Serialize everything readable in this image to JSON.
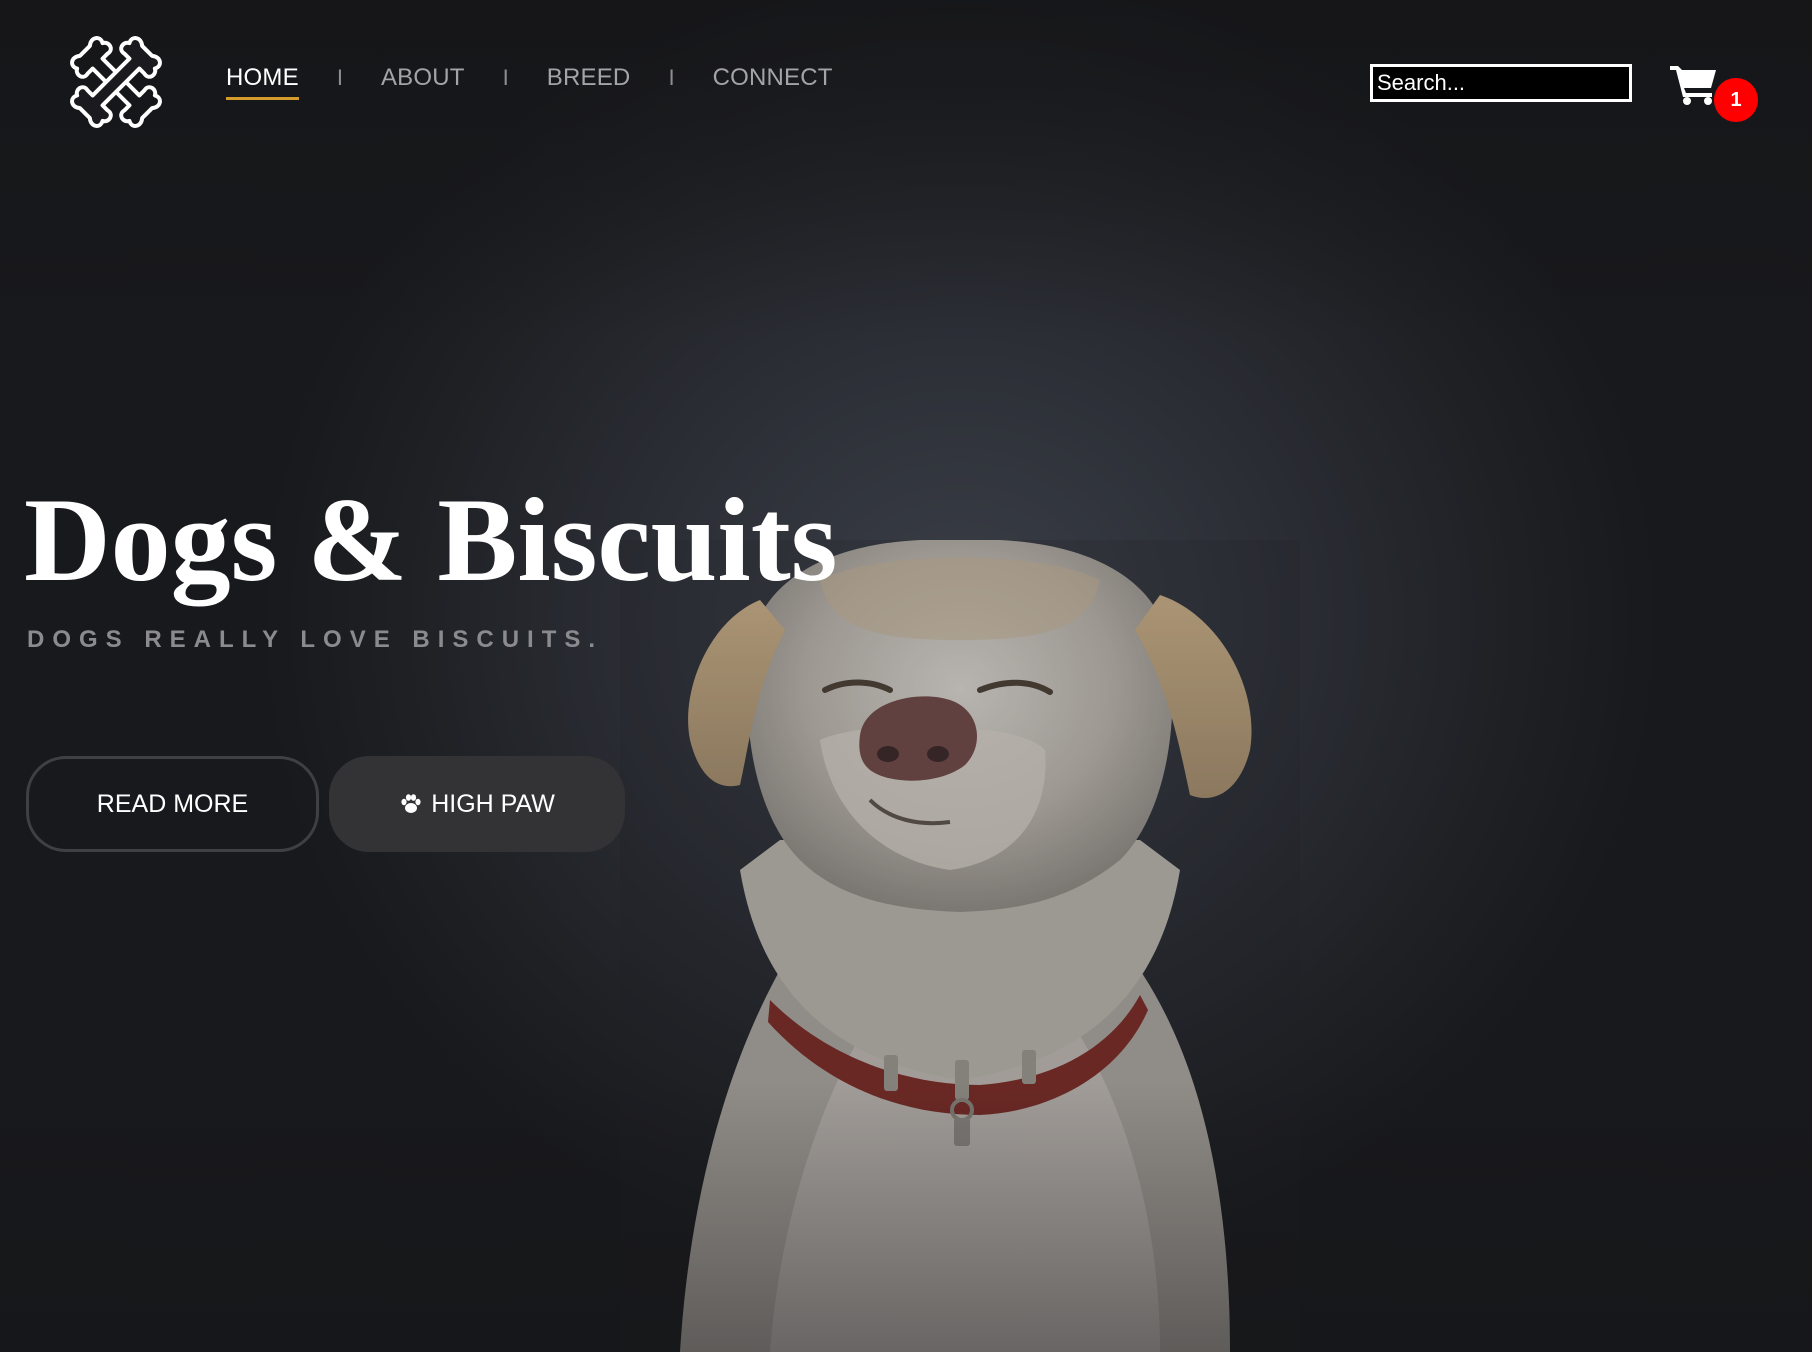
{
  "nav": {
    "items": [
      {
        "label": "HOME",
        "active": true
      },
      {
        "label": "ABOUT",
        "active": false
      },
      {
        "label": "BREED",
        "active": false
      },
      {
        "label": "CONNECT",
        "active": false
      }
    ],
    "separator": "I"
  },
  "search": {
    "placeholder": "Search..."
  },
  "cart": {
    "count": "1",
    "icon": "cart-icon"
  },
  "logo": {
    "icon": "crossed-bones-icon"
  },
  "hero": {
    "title": "Dogs & Biscuits",
    "subtitle": "DOGS REALLY LOVE BISCUITS.",
    "read_more_label": "READ MORE",
    "high_paw_label": "HIGH PAW",
    "high_paw_icon": "paw-icon"
  },
  "colors": {
    "accent": "#d49a2a",
    "badge": "#ff0000",
    "background": "#1b1b1f",
    "button_fill": "#333336"
  }
}
